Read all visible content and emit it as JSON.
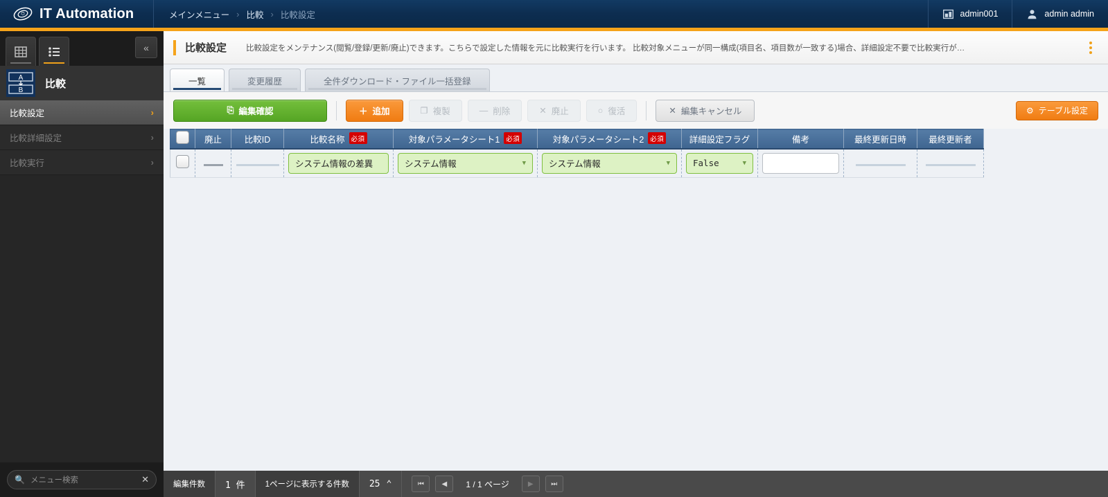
{
  "topbar": {
    "brand": "IT Automation",
    "breadcrumb": [
      {
        "label": "メインメニュー",
        "dim": false
      },
      {
        "label": "比較",
        "dim": false
      },
      {
        "label": "比較設定",
        "dim": true
      }
    ],
    "separator": "›",
    "workspace_user": "admin001",
    "account_name": "admin admin",
    "accent_color": "#f5a31a",
    "bar_color": "#0d2d50"
  },
  "sidebar": {
    "tabs": [
      {
        "name": "grid-view-tab",
        "active": false
      },
      {
        "name": "list-view-tab",
        "active": true
      }
    ],
    "collapse_icon": "«",
    "header_title": "比較",
    "items": [
      {
        "label": "比較設定",
        "selected": true,
        "chevron": "›"
      },
      {
        "label": "比較詳細設定",
        "selected": false,
        "chevron": "›"
      },
      {
        "label": "比較実行",
        "selected": false,
        "chevron": "›"
      }
    ],
    "search_placeholder": "メニュー検索",
    "search_clear": "✕"
  },
  "page": {
    "title": "比較設定",
    "description": "比較設定をメンテナンス(閲覧/登録/更新/廃止)できます。こちらで設定した情報を元に比較実行を行います。 比較対象メニューが同一構成(項目名、項目数が一致する)場合、詳細設定不要で比較実行が…"
  },
  "tabs": [
    {
      "label": "一覧",
      "active": true
    },
    {
      "label": "変更履歴",
      "active": false
    },
    {
      "label": "全件ダウンロード・ファイル一括登録",
      "active": false
    }
  ],
  "toolbar": {
    "confirm_edit": "編集確認",
    "add": "追加",
    "duplicate": "複製",
    "delete": "削除",
    "discard": "廃止",
    "restore": "復活",
    "cancel_edit": "編集キャンセル",
    "table_settings": "テーブル設定",
    "icons": {
      "confirm": "⎘",
      "add": "＋",
      "duplicate": "❐",
      "delete": "—",
      "discard": "✕",
      "restore": "○",
      "cancel": "✕",
      "gear": "⚙"
    }
  },
  "table": {
    "columns": [
      {
        "label": "",
        "name": "select-all",
        "required": false
      },
      {
        "label": "廃止",
        "name": "discard",
        "required": false
      },
      {
        "label": "比較ID",
        "name": "comparison-id",
        "required": false
      },
      {
        "label": "比較名称",
        "name": "comparison-name",
        "required": true
      },
      {
        "label": "対象パラメータシート1",
        "name": "target-sheet-1",
        "required": true
      },
      {
        "label": "対象パラメータシート2",
        "name": "target-sheet-2",
        "required": true
      },
      {
        "label": "詳細設定フラグ",
        "name": "detail-flag",
        "required": false
      },
      {
        "label": "備考",
        "name": "remarks",
        "required": false
      },
      {
        "label": "最終更新日時",
        "name": "last-updated",
        "required": false
      },
      {
        "label": "最終更新者",
        "name": "last-updater",
        "required": false
      }
    ],
    "required_badge": "必須",
    "rows": [
      {
        "comparison_name": "システム情報の差異",
        "target_sheet_1": "システム情報",
        "target_sheet_2": "システム情報",
        "detail_flag": "False",
        "remarks": "",
        "last_updated": "",
        "last_updater": ""
      }
    ],
    "dropdown_caret": "▼"
  },
  "footer": {
    "edit_count_label": "編集件数",
    "edit_count_value": "1 件",
    "per_page_label": "1ページに表示する件数",
    "per_page_value": "25",
    "per_page_caret": "⌃",
    "first_page_icon": "⏮",
    "prev_page_icon": "◀",
    "next_page_icon": "▶",
    "last_page_icon": "⏭",
    "page_text": "1 / 1 ページ"
  }
}
